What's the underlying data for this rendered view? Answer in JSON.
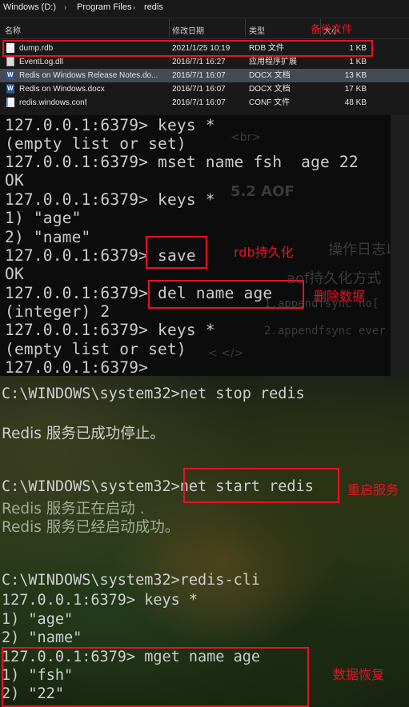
{
  "explorer": {
    "breadcrumb": [
      "Windows (D:)",
      "Program Files",
      "redis"
    ],
    "columns": {
      "name": "名称",
      "modified": "修改日期",
      "type": "类型",
      "size": "大小"
    },
    "files": [
      {
        "name": "dump.rdb",
        "modified": "2021/1/25 10:19",
        "type": "RDB 文件",
        "size": "1 KB",
        "icon": "file-icon"
      },
      {
        "name": "EventLog.dll",
        "modified": "2016/7/1 16:27",
        "type": "应用程序扩展",
        "size": "1 KB",
        "icon": "dll-icon"
      },
      {
        "name": "Redis on Windows Release Notes.do...",
        "modified": "2016/7/1 16:07",
        "type": "DOCX 文档",
        "size": "13 KB",
        "icon": "word-doc-icon"
      },
      {
        "name": "Redis on Windows.docx",
        "modified": "2016/7/1 16:07",
        "type": "DOCX 文档",
        "size": "17 KB",
        "icon": "word-doc-icon"
      },
      {
        "name": "redis.windows.conf",
        "modified": "2016/7/1 16:07",
        "type": "CONF 文件",
        "size": "48 KB",
        "icon": "conf-file-icon"
      }
    ]
  },
  "terminal1": {
    "lines": [
      "127.0.0.1:6379> keys *",
      "(empty list or set)",
      "127.0.0.1:6379> mset name fsh  age 22",
      "OK",
      "127.0.0.1:6379> keys *",
      "1) \"age\"",
      "2) \"name\"",
      "127.0.0.1:6379> save",
      "OK",
      "127.0.0.1:6379> del name age",
      "(integer) 2",
      "127.0.0.1:6379> keys *",
      "(empty list or set)",
      "127.0.0.1:6379>"
    ],
    "background_ghost": [
      "<br>",
      "5.2 AOF",
      "操作日志以文件",
      "aof持久化方式",
      "1.appendfsync no[",
      "2.appendfsync ever",
      "<  </>"
    ]
  },
  "terminal2": {
    "lines": [
      "C:\\WINDOWS\\system32>net stop redis",
      "",
      "Redis 服务已成功停止。",
      "",
      "",
      "C:\\WINDOWS\\system32>net start redis",
      "Redis 服务正在启动 .",
      "Redis 服务已经启动成功。",
      "",
      "",
      "C:\\WINDOWS\\system32>redis-cli",
      "127.0.0.1:6379> keys *",
      "1) \"age\"",
      "2) \"name\"",
      "127.0.0.1:6379> mget name age",
      "1) \"fsh\"",
      "2) \"22\""
    ]
  },
  "annotations": {
    "backup": "备份文件",
    "rdb": "rdb持久化",
    "delete": "删除数据",
    "restart": "重启服务",
    "restore": "数据恢复"
  },
  "colors": {
    "annotation": "#e81224",
    "terminal_bg": "#0c0c0c",
    "explorer_bg": "#191919",
    "selection": "#444b55"
  }
}
